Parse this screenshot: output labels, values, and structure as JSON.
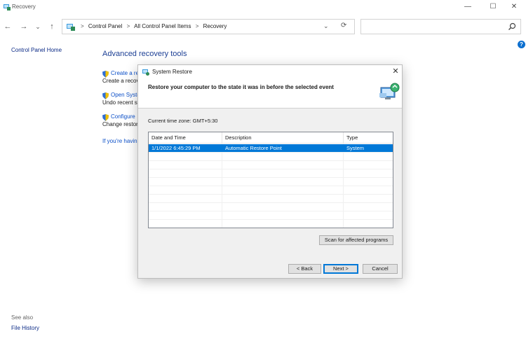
{
  "window": {
    "title": "Recovery",
    "minimize": "—",
    "maximize": "☐",
    "close": "✕"
  },
  "nav": {
    "back": "←",
    "forward": "→",
    "recent": "⌄",
    "up": "↑",
    "breadcrumbs": [
      "Control Panel",
      "All Control Panel Items",
      "Recovery"
    ],
    "breadcrumb_sep": ">",
    "dropdown": "⌄",
    "refresh": "⟳",
    "search_placeholder": ""
  },
  "help": "?",
  "left_pane": {
    "home": "Control Panel Home",
    "see_also": "See also",
    "file_history": "File History"
  },
  "main": {
    "heading": "Advanced recovery tools",
    "tools": [
      {
        "link": "Create a re",
        "desc": "Create a recov"
      },
      {
        "link": "Open Syste",
        "desc": "Undo recent sy"
      },
      {
        "link": "Configure",
        "desc": "Change restor"
      }
    ],
    "trouble_link": "If you're havin"
  },
  "dialog": {
    "title": "System Restore",
    "close": "✕",
    "heading": "Restore your computer to the state it was in before the selected event",
    "timezone": "Current time zone: GMT+5:30",
    "columns": [
      "Date and Time",
      "Description",
      "Type"
    ],
    "sort_indicator": "˄",
    "rows": [
      {
        "date": "1/1/2022 6:45:29 PM",
        "description": "Automatic Restore Point",
        "type": "System",
        "selected": true
      }
    ],
    "scan_button": "Scan for affected programs",
    "back_button": "< Back",
    "next_button": "Next >",
    "cancel_button": "Cancel"
  },
  "colors": {
    "selection": "#0078d7",
    "link": "#0b4fc8",
    "heading": "#1c3f94"
  }
}
